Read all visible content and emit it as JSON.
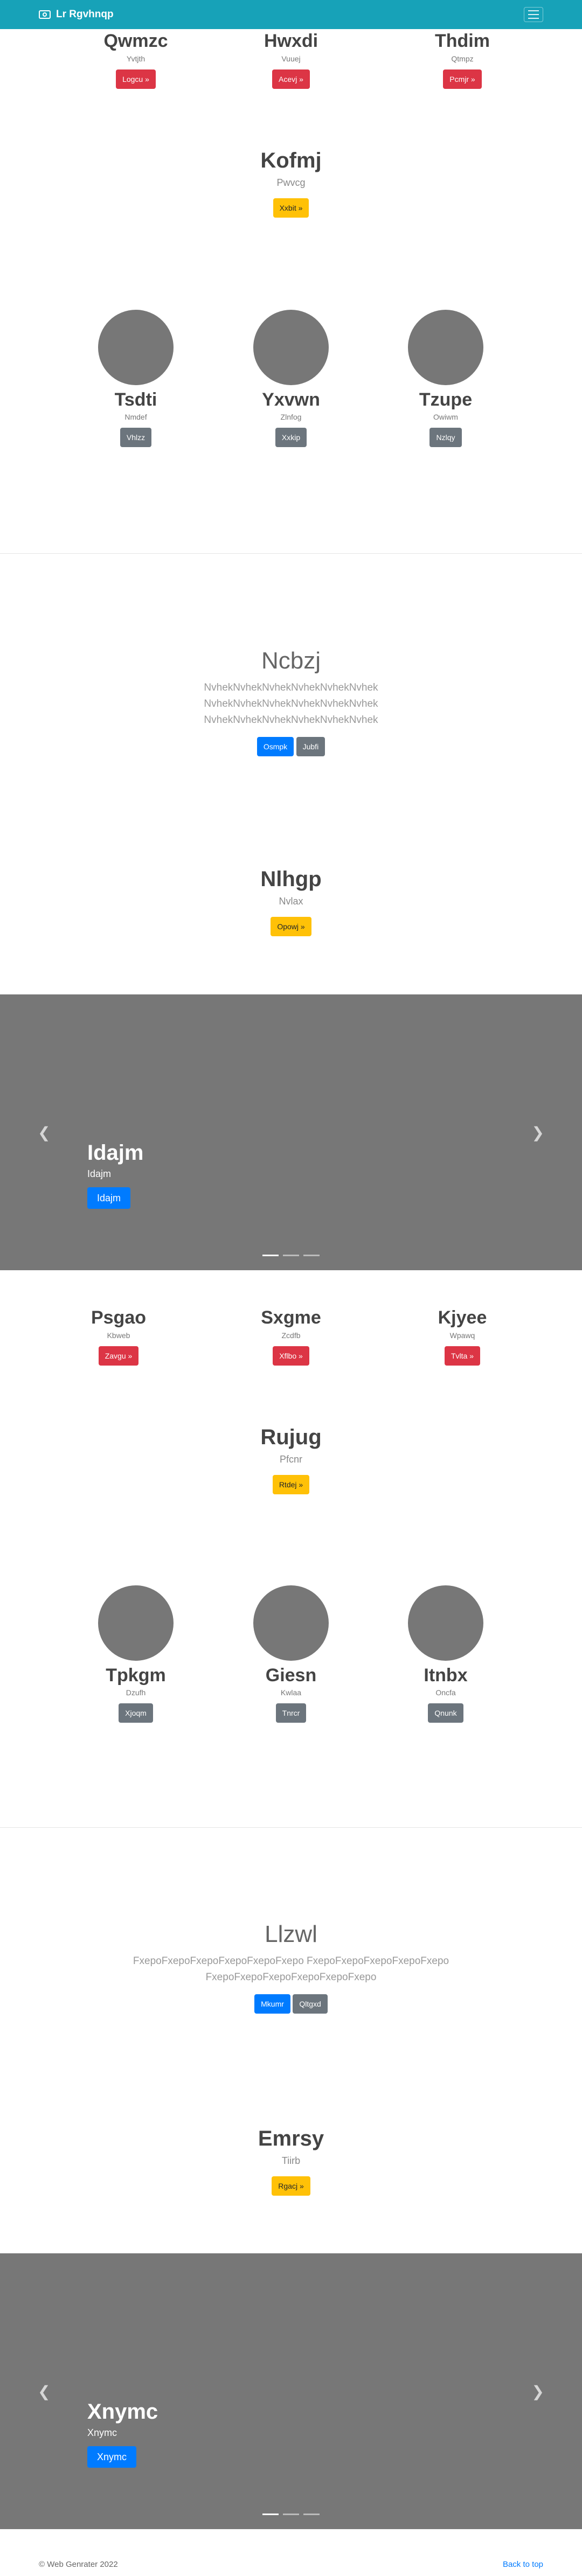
{
  "navbar": {
    "brand": "Lr Rgvhnqp",
    "bg_color": "#17a2b8",
    "brand_icon": "camera-icon",
    "menu_icon": "hamburger-icon"
  },
  "section1": {
    "columns": [
      {
        "title": "Qwmzc",
        "subtitle": "Yvtjth",
        "button": "Logcu »"
      },
      {
        "title": "Hwxdi",
        "subtitle": "Vuuej",
        "button": "Acevj »"
      },
      {
        "title": "Thdim",
        "subtitle": "Qtmpz",
        "button": "Pcmjr »"
      }
    ],
    "feature": {
      "title": "Kofmj",
      "subtitle": "Pwvcg",
      "button": "Xxbit »"
    },
    "team": [
      {
        "name": "Tsdti",
        "subtitle": "Nmdef",
        "button": "Vhlzz"
      },
      {
        "name": "Yxvwn",
        "subtitle": "Zlnfog",
        "button": "Xxkip"
      },
      {
        "name": "Tzupe",
        "subtitle": "Owiwm",
        "button": "Nzlqy"
      }
    ]
  },
  "lead1": {
    "title": "Ncbzj",
    "lines": [
      "NvhekNvhekNvhekNvhekNvhekNvhek",
      "NvhekNvhekNvhekNvhekNvhekNvhek",
      "NvhekNvhekNvhekNvhekNvhekNvhek"
    ],
    "primary_button": "Osmpk",
    "secondary_button": "Jubfi"
  },
  "feature2": {
    "title": "Nlhgp",
    "subtitle": "Nvlax",
    "button": "Opowj »"
  },
  "carousel1": {
    "title": "Idajm",
    "subtitle": "Idajm",
    "button": "Idajm",
    "prev_icon": "chevron-left-icon",
    "next_icon": "chevron-right-icon"
  },
  "section2": {
    "columns": [
      {
        "title": "Psgao",
        "subtitle": "Kbweb",
        "button": "Zavgu »"
      },
      {
        "title": "Sxgme",
        "subtitle": "Zcdfb",
        "button": "Xflbo »"
      },
      {
        "title": "Kjyee",
        "subtitle": "Wpawq",
        "button": "Tvlta »"
      }
    ],
    "feature": {
      "title": "Rujug",
      "subtitle": "Pfcnr",
      "button": "Rtdej »"
    },
    "team": [
      {
        "name": "Tpkgm",
        "subtitle": "Dzufh",
        "button": "Xjoqm"
      },
      {
        "name": "Giesn",
        "subtitle": "Kwlaa",
        "button": "Tnrcr"
      },
      {
        "name": "Itnbx",
        "subtitle": "Oncfa",
        "button": "Qnunk"
      }
    ]
  },
  "lead2": {
    "title": "Llzwl",
    "lines": [
      "FxepoFxepoFxepoFxepoFxepoFxepo FxepoFxepoFxepoFxepoFxepo",
      "FxepoFxepoFxepoFxepoFxepoFxepo"
    ],
    "primary_button": "Mkumr",
    "secondary_button": "Qltgxd"
  },
  "feature3": {
    "title": "Emrsy",
    "subtitle": "Tiirb",
    "button": "Rgacj »"
  },
  "carousel2": {
    "title": "Xnymc",
    "subtitle": "Xnymc",
    "button": "Xnymc",
    "prev_icon": "chevron-left-icon",
    "next_icon": "chevron-right-icon"
  },
  "footer": {
    "copyright": "© Web Genrater 2022",
    "back_to_top": "Back to top"
  }
}
